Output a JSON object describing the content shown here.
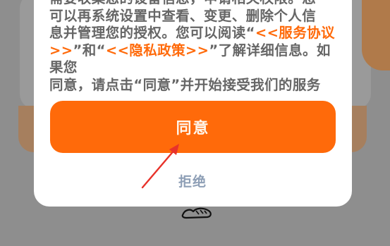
{
  "dialog": {
    "text_line1": "需要收集您的设备信息，申请相关权限。您",
    "text_line2": "可以再系统设置中查看、变更、删除个人信",
    "text_line3_pre": "息并管理您的授权。您可以阅读“",
    "service_link_part1": "<<服务协议",
    "service_link_part2": ">>",
    "text_and": "”和“",
    "privacy_link": "<<隐私政策>>",
    "text_line4_post": "”了解详细信息。如果您",
    "text_line5": "同意，请点击“同意”并开始接受我们的服务",
    "agree_label": "同意",
    "decline_label": "拒绝"
  },
  "colors": {
    "accent": "#ff6a0a",
    "decline_text": "#8e9fb6",
    "body_text": "#666666",
    "overlay": "#8e8e8e",
    "annotation_arrow": "#e8322a"
  },
  "icons": {
    "background_doodle": "shoe-doodle-icon",
    "annotation": "red-arrow-icon"
  }
}
